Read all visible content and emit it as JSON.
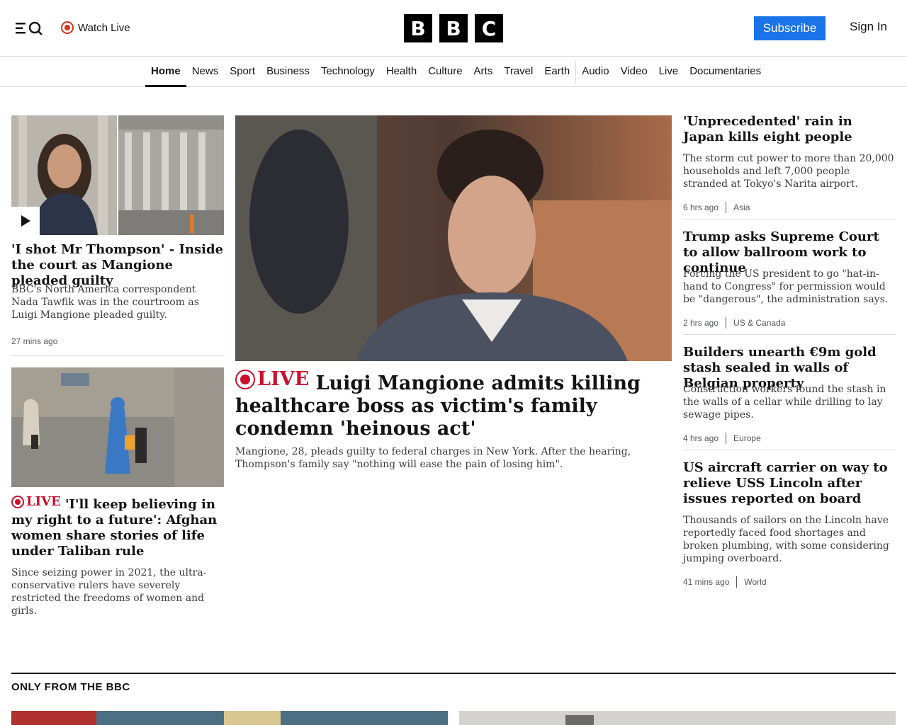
{
  "header": {
    "watch_live_label": "Watch Live",
    "logo_letters": [
      "B",
      "B",
      "C"
    ],
    "subscribe_label": "Subscribe",
    "sign_in_label": "Sign In",
    "accent_color": "#1a73e8",
    "live_color": "#d4351c"
  },
  "nav": {
    "items": [
      "Home",
      "News",
      "Sport",
      "Business",
      "Technology",
      "Health",
      "Culture",
      "Arts",
      "Travel",
      "Earth",
      "Audio",
      "Video",
      "Live",
      "Documentaries"
    ],
    "active": "Home"
  },
  "left_column": {
    "story1": {
      "headline": "'I shot Mr Thompson' - Inside the court as Mangione pleaded guilty",
      "summary": "BBC's North America correspondent Nada Tawfik was in the courtroom as Luigi Mangione pleaded guilty.",
      "time": "27 mins ago",
      "media_icon": "play-icon"
    },
    "story2": {
      "live_label": "LIVE",
      "headline": "'I'll keep believing in my right to a future': Afghan women share stories of life under Taliban rule",
      "summary": "Since seizing power in 2021, the ultra-conservative rulers have severely restricted the freedoms of women and girls."
    }
  },
  "center": {
    "live_label": "LIVE",
    "headline": "Luigi Mangione admits killing healthcare boss as victim's family condemn 'heinous act'",
    "summary": "Mangione, 28, pleads guilty to federal charges in New York. After the hearing, Thompson's family say \"nothing will ease the pain of losing him\"."
  },
  "right_column": {
    "stories": [
      {
        "headline": "'Unprecedented' rain in Japan kills eight people",
        "summary": "The storm cut power to more than 20,000 households and left 7,000 people stranded at Tokyo's Narita airport.",
        "time": "6 hrs ago",
        "section": "Asia"
      },
      {
        "headline": "Trump asks Supreme Court to allow ballroom work to continue",
        "summary": "Forcing the US president to go \"hat-in-hand to Congress\" for permission would be \"dangerous\", the administration says.",
        "time": "2 hrs ago",
        "section": "US & Canada"
      },
      {
        "headline": "Builders unearth €9m gold stash sealed in walls of Belgian property",
        "summary": "Construction workers found the stash in the walls of a cellar while drilling to lay sewage pipes.",
        "time": "4 hrs ago",
        "section": "Europe"
      },
      {
        "headline": "US aircraft carrier on way to relieve USS Lincoln after issues reported on board",
        "summary": "Thousands of sailors on the Lincoln have reportedly faced food shortages and broken plumbing, with some considering jumping overboard.",
        "time": "41 mins ago",
        "section": "World"
      }
    ]
  },
  "section": {
    "title": "ONLY FROM THE BBC"
  }
}
